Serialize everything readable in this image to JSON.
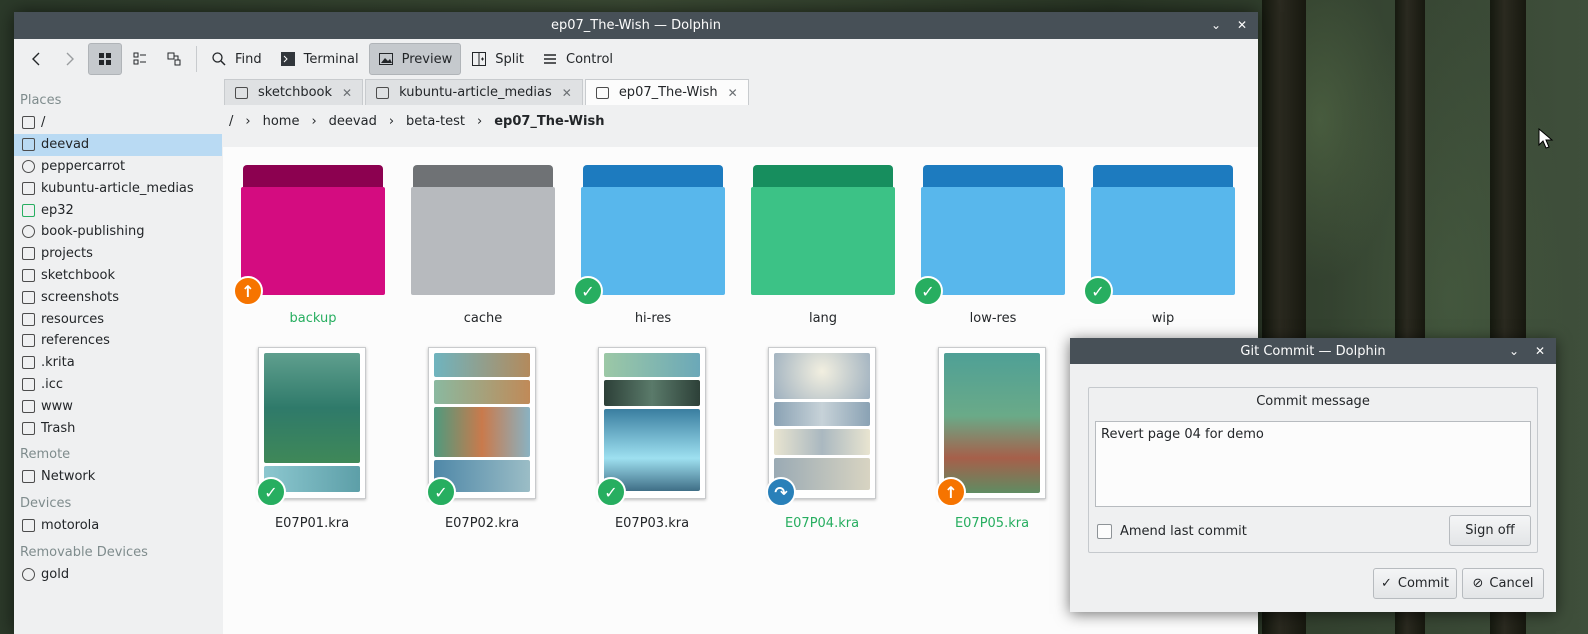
{
  "main_window": {
    "title": "ep07_The-Wish — Dolphin",
    "toolbar": {
      "find": "Find",
      "terminal": "Terminal",
      "preview": "Preview",
      "split": "Split",
      "control": "Control"
    },
    "places": {
      "header": "Places",
      "items": [
        "/",
        "deevad",
        "peppercarrot",
        "kubuntu-article_medias",
        "ep32",
        "book-publishing",
        "projects",
        "sketchbook",
        "screenshots",
        "resources",
        "references",
        ".krita",
        ".icc",
        "www",
        "Trash"
      ],
      "remote_header": "Remote",
      "remote_items": [
        "Network"
      ],
      "devices_header": "Devices",
      "devices_items": [
        "motorola"
      ],
      "removable_header": "Removable Devices",
      "removable_items": [
        "gold"
      ]
    },
    "tabs": [
      "sketchbook",
      "kubuntu-article_medias",
      "ep07_The-Wish"
    ],
    "breadcrumb": [
      "/",
      "home",
      "deevad",
      "beta-test",
      "ep07_The-Wish"
    ],
    "folders": [
      {
        "name": "backup",
        "color": "#c2006a",
        "status": "modified"
      },
      {
        "name": "cache",
        "color": "#a0a4a8",
        "status": "none"
      },
      {
        "name": "hi-res",
        "color": "#47a8e8",
        "status": "clean"
      },
      {
        "name": "lang",
        "color": "#2eb67a",
        "status": "none"
      },
      {
        "name": "low-res",
        "color": "#47a8e8",
        "status": "clean"
      },
      {
        "name": "wip",
        "color": "#47a8e8",
        "status": "clean"
      }
    ],
    "files": [
      {
        "name": "E07P01.kra",
        "status": "clean"
      },
      {
        "name": "E07P02.kra",
        "status": "clean"
      },
      {
        "name": "E07P03.kra",
        "status": "clean"
      },
      {
        "name": "E07P04.kra",
        "status": "moved"
      },
      {
        "name": "E07P05.kra",
        "status": "modified"
      }
    ]
  },
  "commit_dialog": {
    "title": "Git Commit — Dolphin",
    "group_title": "Commit message",
    "message": "Revert page 04 for demo",
    "amend_label": "Amend last commit",
    "sign_off": "Sign off",
    "commit": "Commit",
    "cancel": "Cancel"
  },
  "colors": {
    "titlebar": "#475057",
    "selection": "#b9daf3",
    "git_clean": "#27ae60",
    "git_modified": "#f67400",
    "git_moved": "#2980b9"
  }
}
